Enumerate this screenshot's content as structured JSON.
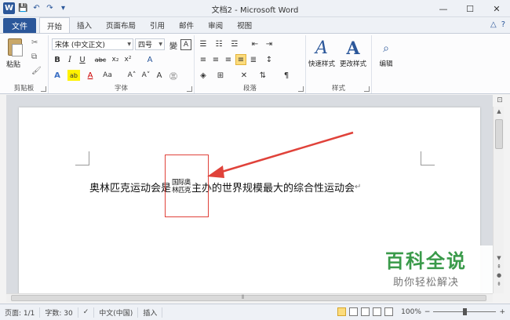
{
  "window": {
    "title": "文档2 - Microsoft Word",
    "logo_letter": "W",
    "controls": {
      "minimize": "—",
      "maximize": "☐",
      "close": "✕"
    }
  },
  "qat": {
    "save": "💾",
    "undo": "↶",
    "redo": "↷",
    "customize": "▾"
  },
  "tabs": {
    "file": "文件",
    "items": [
      "开始",
      "插入",
      "页面布局",
      "引用",
      "邮件",
      "审阅",
      "视图"
    ],
    "active_index": 0,
    "right_icons": [
      "△",
      "?"
    ]
  },
  "ribbon": {
    "clipboard": {
      "label": "剪贴板",
      "paste": "粘贴",
      "cut": "✂",
      "copy": "⧉",
      "format_painter": "🖌"
    },
    "font": {
      "label": "字体",
      "font_name": "宋体 (中文正文)",
      "font_size": "四号",
      "bold": "B",
      "italic": "I",
      "underline": "U",
      "strike": "abc",
      "subscript": "x₂",
      "superscript": "x²",
      "text_effects": "A",
      "highlight": "ab",
      "font_color": "A",
      "change_case": "Aa",
      "grow": "A˄",
      "shrink": "A˅",
      "clear": "A",
      "phonetic": "變",
      "border_char": "A",
      "enclosed": "㊂"
    },
    "paragraph": {
      "label": "段落"
    },
    "styles": {
      "label": "样式",
      "quick_styles": "快速样式",
      "change_styles": "更改样式"
    },
    "editing": {
      "label": "编辑"
    }
  },
  "document": {
    "text_before": "奥林匹克运动会是",
    "combine_line1": "国际奥",
    "combine_line2": "林匹克",
    "text_after": "主办的世界规模最大的综合性运动会",
    "para_mark": "↵",
    "accent_color": "#e0423a"
  },
  "watermark": {
    "title": "百科全说",
    "subtitle": "助你轻松解决"
  },
  "statusbar": {
    "page": "页面: 1/1",
    "words": "字数: 30",
    "language": "中文(中国)",
    "mode": "插入",
    "zoom": "100%",
    "zoom_minus": "−",
    "zoom_plus": "+"
  }
}
